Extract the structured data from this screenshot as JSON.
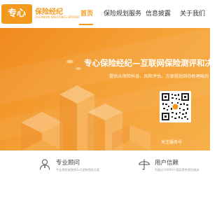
{
  "logo": {
    "badge": "专心",
    "name": "保险经纪",
    "tagline": "ZHUANXIN INSURANCE BROKER"
  },
  "nav": {
    "items": [
      {
        "label": "首页"
      },
      {
        "label": "保险规划服务"
      },
      {
        "label": "信息披露"
      },
      {
        "label": "关于我们"
      }
    ]
  },
  "hero": {
    "title": "专心保险经纪—互联网保险测评和决策平台",
    "subtitle": "提供从保险科普、风险评估、方案规划到协助理赔的",
    "qr_label": "关注服务号"
  },
  "features": [
    {
      "title": "专业顾问",
      "desc": "专业保险规划师1v1定制保险方案",
      "icon": "person-icon"
    },
    {
      "title": "用户信赖",
      "desc": "为超过10000个家庭提供保险服务",
      "icon": "umbrella-icon"
    }
  ],
  "colors": {
    "accent": "#f39a1e",
    "hero_start": "#f08a1d",
    "hero_end": "#f7b04a"
  }
}
